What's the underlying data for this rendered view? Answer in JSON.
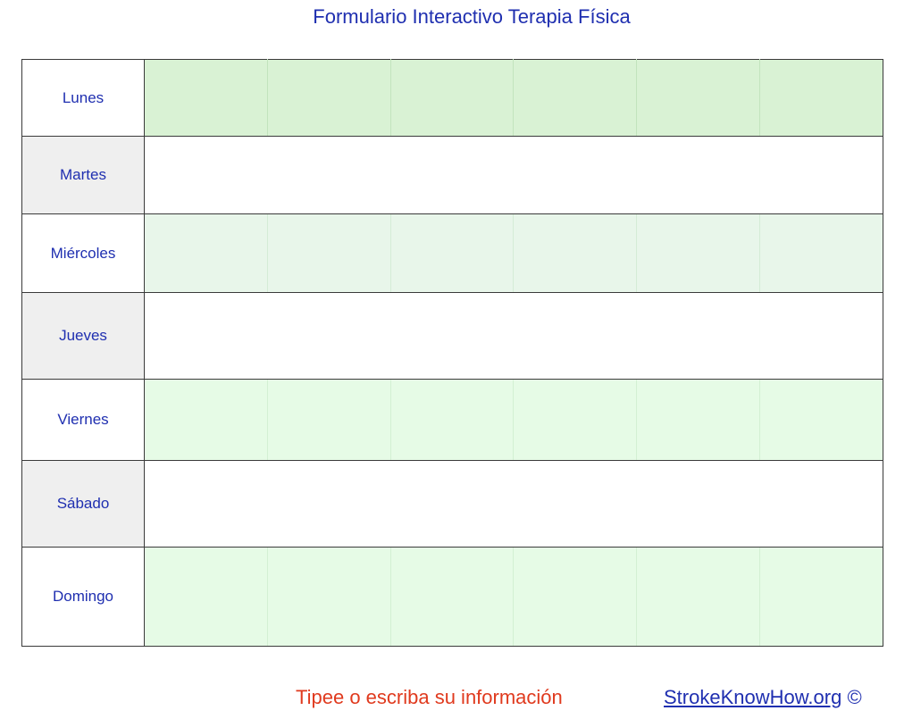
{
  "title": "Formulario Interactivo Terapia Física",
  "days": [
    "Lunes",
    "Martes",
    "Miércoles",
    "Jueves",
    "Viernes",
    "Sábado",
    "Domingo"
  ],
  "footer": {
    "note": "Tipee o escriba su información",
    "link": "StrokeKnowHow.org",
    "copyright": "©"
  },
  "colors": {
    "text_blue": "#1f2fb0",
    "note_red": "#e03a1e",
    "row_green_1": "#d9f2d4",
    "row_green_2": "#e8f6ea",
    "row_green_3": "#e6fbe6",
    "day_gray": "#efefef"
  }
}
